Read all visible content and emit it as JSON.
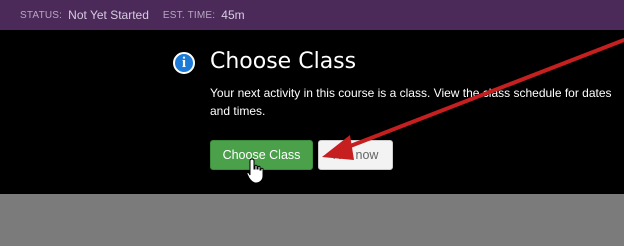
{
  "status_bar": {
    "status_label": "STATUS:",
    "status_value": "Not Yet Started",
    "est_label": "EST. TIME:",
    "est_value": "45m"
  },
  "modal": {
    "icon": "info-icon",
    "title": "Choose Class",
    "description": "Your next activity in this course is a class. View the class schedule for dates and times.",
    "primary_button": "Choose Class",
    "secondary_button": "Not now"
  },
  "colors": {
    "topbar_bg": "#4b2a5a",
    "primary_button_bg": "#4aa14a",
    "info_icon_bg": "#1c7ad8",
    "annotation_arrow": "#c51f1f"
  }
}
